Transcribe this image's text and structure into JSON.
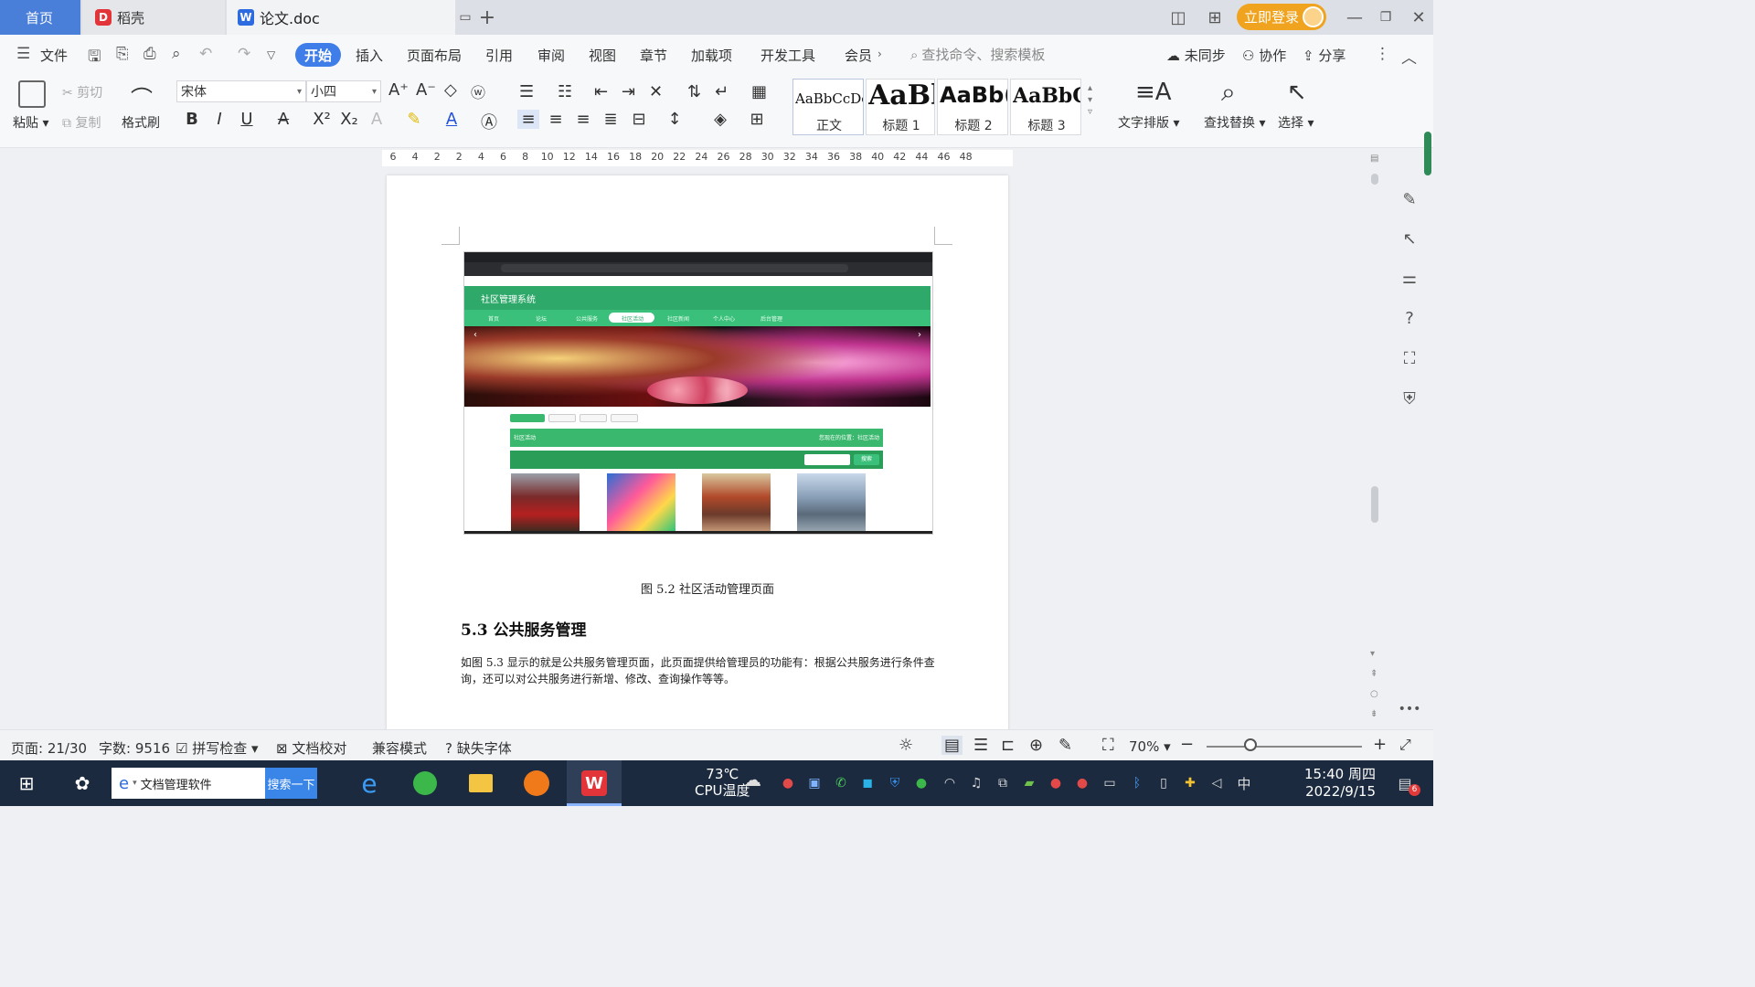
{
  "titlebar": {
    "tabs": [
      {
        "label": "首页"
      },
      {
        "label": "稻壳"
      },
      {
        "label": "论文.doc"
      }
    ],
    "login_label": "立即登录"
  },
  "menubar": {
    "file": "文件",
    "items": [
      "开始",
      "插入",
      "页面布局",
      "引用",
      "审阅",
      "视图",
      "章节",
      "加载项",
      "开发工具",
      "会员"
    ],
    "search_placeholder": "查找命令、搜索模板",
    "sync": "未同步",
    "collab": "协作",
    "share": "分享"
  },
  "ribbon": {
    "paste": "粘贴",
    "cut": "剪切",
    "copy": "复制",
    "format_painter": "格式刷",
    "font_name": "宋体",
    "font_size": "小四",
    "styles": [
      {
        "sample": "AaBbCcDc",
        "label": "正文"
      },
      {
        "sample": "AaBl",
        "label": "标题 1"
      },
      {
        "sample": "AaBb(",
        "label": "标题 2"
      },
      {
        "sample": "AaBbC",
        "label": "标题 3"
      }
    ],
    "text_layout": "文字排版",
    "find_replace": "查找替换",
    "select": "选择"
  },
  "ruler": {
    "ticks": [
      "6",
      "4",
      "2",
      "2",
      "4",
      "6",
      "8",
      "10",
      "12",
      "14",
      "16",
      "18",
      "20",
      "22",
      "24",
      "26",
      "28",
      "30",
      "32",
      "34",
      "36",
      "38",
      "40",
      "42",
      "44",
      "46",
      "48"
    ]
  },
  "document": {
    "screenshot": {
      "site_title": "社区管理系统",
      "nav": [
        "首页",
        "论坛",
        "公共服务",
        "社区活动",
        "社区新闻",
        "个人中心",
        "后台管理"
      ],
      "active_nav": "社区活动",
      "section_bar": "社区活动",
      "section_right": "您现在的位置：社区活动",
      "search_btn": "搜索"
    },
    "caption": "图 5.2  社区活动管理页面",
    "heading": "5.3 公共服务管理",
    "paragraph": "如图 5.3 显示的就是公共服务管理页面，此页面提供给管理员的功能有：根据公共服务进行条件查询，还可以对公共服务进行新增、修改、查询操作等等。"
  },
  "statusbar": {
    "page": "页面: 21/30",
    "words": "字数: 9516",
    "spell": "拼写检查",
    "proof": "文档校对",
    "compat": "兼容模式",
    "missing_font": "缺失字体",
    "zoom": "70%",
    "zoom_fraction": 0.28
  },
  "taskbar": {
    "search_text": "文档管理软件",
    "search_btn": "搜索一下",
    "temp": "73℃",
    "temp_label": "CPU温度",
    "ime": "中",
    "time": "15:40 周四",
    "date": "2022/9/15",
    "notif_count": "6"
  }
}
